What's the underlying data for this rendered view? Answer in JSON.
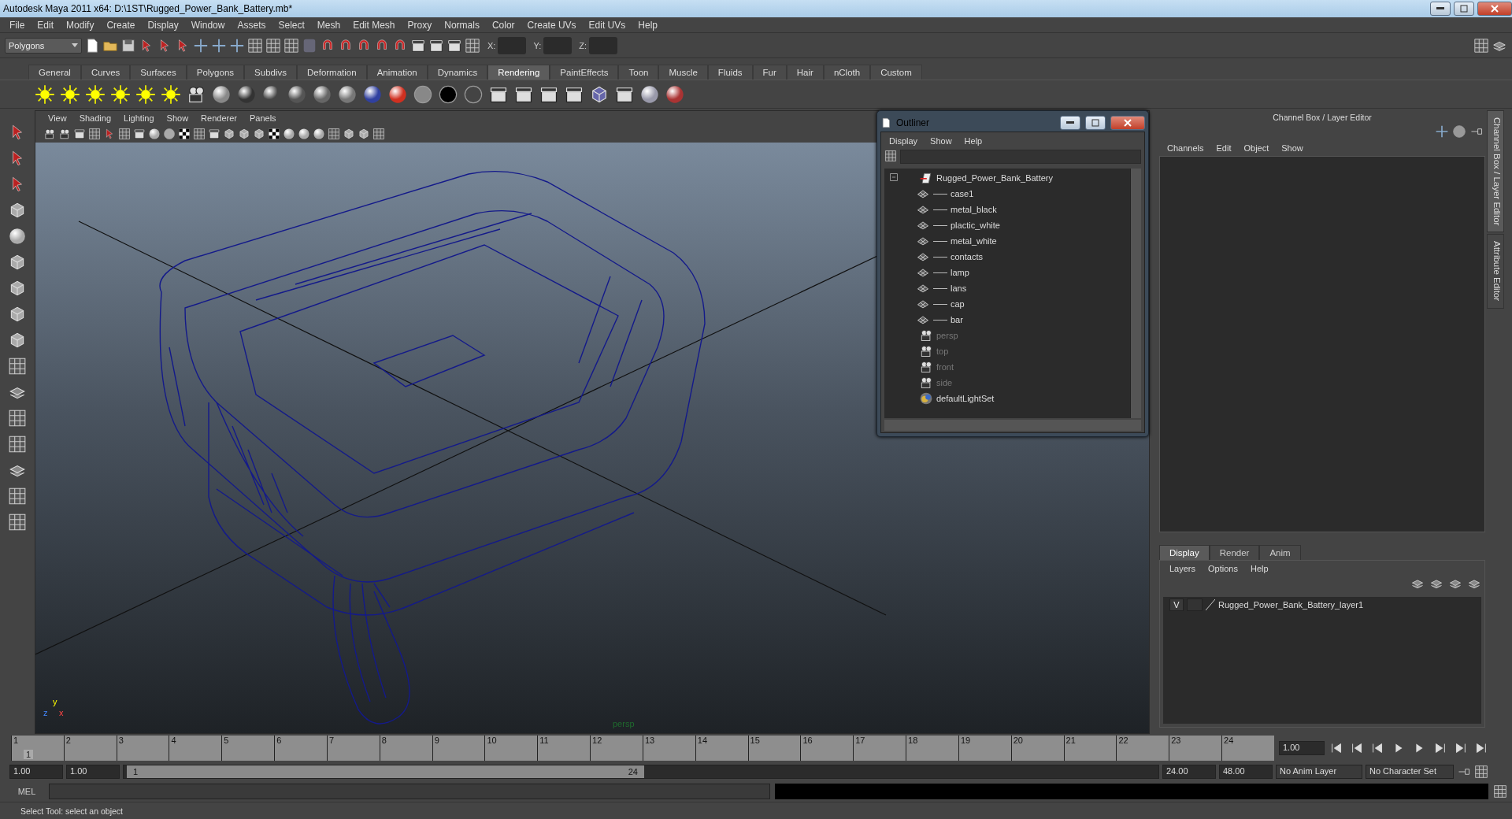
{
  "window": {
    "title": "Autodesk Maya 2011 x64: D:\\1ST\\Rugged_Power_Bank_Battery.mb*"
  },
  "menubar": [
    "File",
    "Edit",
    "Modify",
    "Create",
    "Display",
    "Window",
    "Assets",
    "Select",
    "Mesh",
    "Edit Mesh",
    "Proxy",
    "Normals",
    "Color",
    "Create UVs",
    "Edit UVs",
    "Help"
  ],
  "status_line": {
    "mode": "Polygons",
    "coord_labels": [
      "X:",
      "Y:",
      "Z:"
    ]
  },
  "shelf_tabs": [
    {
      "label": "General",
      "selected": false
    },
    {
      "label": "Curves",
      "selected": false
    },
    {
      "label": "Surfaces",
      "selected": false
    },
    {
      "label": "Polygons",
      "selected": false
    },
    {
      "label": "Subdivs",
      "selected": false
    },
    {
      "label": "Deformation",
      "selected": false
    },
    {
      "label": "Animation",
      "selected": false
    },
    {
      "label": "Dynamics",
      "selected": false
    },
    {
      "label": "Rendering",
      "selected": true
    },
    {
      "label": "PaintEffects",
      "selected": false
    },
    {
      "label": "Toon",
      "selected": false
    },
    {
      "label": "Muscle",
      "selected": false
    },
    {
      "label": "Fluids",
      "selected": false
    },
    {
      "label": "Fur",
      "selected": false
    },
    {
      "label": "Hair",
      "selected": false
    },
    {
      "label": "nCloth",
      "selected": false
    },
    {
      "label": "Custom",
      "selected": false
    }
  ],
  "viewport": {
    "menus": [
      "View",
      "Shading",
      "Lighting",
      "Show",
      "Renderer",
      "Panels"
    ],
    "camera_label": "persp",
    "axis_labels": [
      "y",
      "z",
      "x"
    ]
  },
  "outliner": {
    "title": "Outliner",
    "menus": [
      "Display",
      "Show",
      "Help"
    ],
    "items": [
      {
        "name": "Rugged_Power_Bank_Battery",
        "kind": "group",
        "hidden": false,
        "expanded": true,
        "children": [
          {
            "name": "case1",
            "kind": "mesh",
            "hidden": false
          },
          {
            "name": "metal_black",
            "kind": "mesh",
            "hidden": false
          },
          {
            "name": "plactic_white",
            "kind": "mesh",
            "hidden": false
          },
          {
            "name": "metal_white",
            "kind": "mesh",
            "hidden": false
          },
          {
            "name": "contacts",
            "kind": "mesh",
            "hidden": false
          },
          {
            "name": "lamp",
            "kind": "mesh",
            "hidden": false
          },
          {
            "name": "lans",
            "kind": "mesh",
            "hidden": false
          },
          {
            "name": "cap",
            "kind": "mesh",
            "hidden": false
          },
          {
            "name": "bar",
            "kind": "mesh",
            "hidden": false
          }
        ]
      },
      {
        "name": "persp",
        "kind": "camera",
        "hidden": true
      },
      {
        "name": "top",
        "kind": "camera",
        "hidden": true
      },
      {
        "name": "front",
        "kind": "camera",
        "hidden": true
      },
      {
        "name": "side",
        "kind": "camera",
        "hidden": true
      },
      {
        "name": "defaultLightSet",
        "kind": "set",
        "hidden": false
      }
    ]
  },
  "channel_box": {
    "title": "Channel Box / Layer Editor",
    "menus": [
      "Channels",
      "Edit",
      "Object",
      "Show"
    ],
    "side_tabs": [
      {
        "label": "Channel Box / Layer Editor",
        "selected": true
      },
      {
        "label": "Attribute Editor",
        "selected": false
      }
    ],
    "layer_tabs": [
      {
        "label": "Display",
        "selected": true
      },
      {
        "label": "Render",
        "selected": false
      },
      {
        "label": "Anim",
        "selected": false
      }
    ],
    "layer_menus": [
      "Layers",
      "Options",
      "Help"
    ],
    "layers": [
      {
        "visibility": "V",
        "name": "Rugged_Power_Bank_Battery_layer1"
      }
    ]
  },
  "timeline": {
    "ticks": [
      "1",
      "2",
      "3",
      "4",
      "5",
      "6",
      "7",
      "8",
      "9",
      "10",
      "11",
      "12",
      "13",
      "14",
      "15",
      "16",
      "17",
      "18",
      "19",
      "20",
      "21",
      "22",
      "23",
      "24"
    ],
    "current_frame": "1",
    "current_time": "1.00"
  },
  "range": {
    "start": "1.00",
    "playback_start": "1.00",
    "level": 0.5,
    "slider_start": "1",
    "slider_end": "24",
    "playback_end": "24.00",
    "end": "48.00",
    "anim_layer": "No Anim Layer",
    "character_set": "No Character Set"
  },
  "command_line": {
    "label": "MEL"
  },
  "help_line": "Select Tool: select an object"
}
